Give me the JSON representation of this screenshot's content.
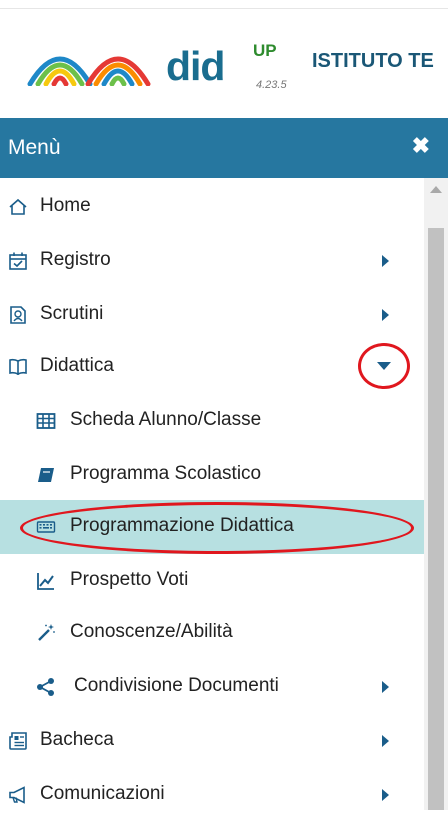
{
  "header": {
    "brand": "did",
    "brand_superscript": "UP",
    "version": "4.23.5",
    "school_name": "ISTITUTO TE"
  },
  "menu": {
    "title": "Menù",
    "close_label": "✖",
    "items": [
      {
        "label": "Home",
        "icon": "home-icon"
      },
      {
        "label": "Registro",
        "icon": "calendar-check-icon"
      },
      {
        "label": "Scrutini",
        "icon": "scrutini-icon"
      },
      {
        "label": "Didattica",
        "icon": "book-open-icon",
        "expanded": true,
        "children": [
          {
            "label": "Scheda Alunno/Classe",
            "icon": "table-icon"
          },
          {
            "label": "Programma Scolastico",
            "icon": "book-icon"
          },
          {
            "label": "Programmazione Didattica",
            "icon": "keyboard-icon",
            "active": true
          },
          {
            "label": "Prospetto Voti",
            "icon": "line-chart-icon"
          },
          {
            "label": "Conoscenze/Abilità",
            "icon": "magic-wand-icon"
          },
          {
            "label": "Condivisione Documenti",
            "icon": "share-icon"
          }
        ]
      },
      {
        "label": "Bacheca",
        "icon": "newspaper-icon"
      },
      {
        "label": "Comunicazioni",
        "icon": "megaphone-icon"
      }
    ]
  },
  "colors": {
    "menu_header_bg": "#2677a0",
    "active_item_bg": "#b7e0e1",
    "annotation_red": "#e0171e",
    "brand_blue": "#1a6d8f",
    "brand_green": "#2e8b2e"
  }
}
